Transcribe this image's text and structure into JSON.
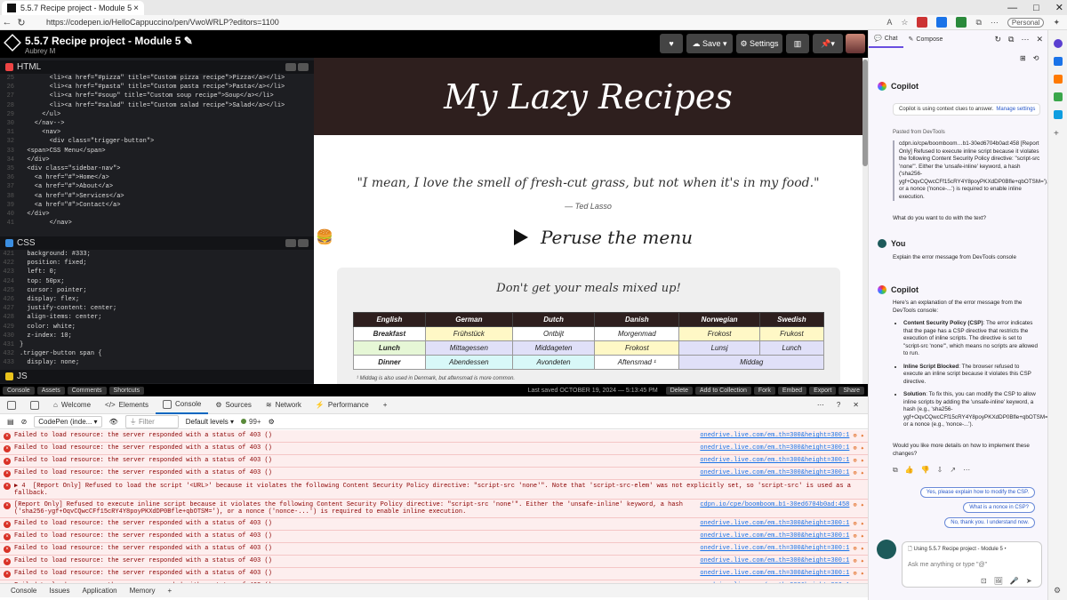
{
  "browser": {
    "tab_title": "5.5.7 Recipe project - Module 5",
    "url": "https://codepen.io/HelloCappuccino/pen/VwoWRLP?editors=1100",
    "profile": "Personal"
  },
  "codepen": {
    "title": "5.5.7 Recipe project - Module 5",
    "user": "Aubrey M",
    "save": "Save",
    "settings": "Settings",
    "footer": {
      "buttons": [
        "Console",
        "Assets",
        "Comments",
        "Shortcuts"
      ],
      "saved": "Last saved OCTOBER 19, 2024 — 5:13:45 PM",
      "actions": [
        "Delete",
        "Add to Collection",
        "Fork",
        "Embed",
        "Export",
        "Share"
      ]
    }
  },
  "editors": {
    "html_label": "HTML",
    "css_label": "CSS",
    "js_label": "JS",
    "html_lines": [
      {
        "n": "25",
        "t": "        <li><a href=\"#pizza\" title=\"Custom pizza recipe\">Pizza</a></li>"
      },
      {
        "n": "26",
        "t": "        <li><a href=\"#pasta\" title=\"Custom pasta recipe\">Pasta</a></li>"
      },
      {
        "n": "27",
        "t": "        <li><a href=\"#soup\" title=\"Custom soup recipe\">Soup</a></li>"
      },
      {
        "n": "28",
        "t": "        <li><a href=\"#salad\" title=\"Custom salad recipe\">Salad</a></li>"
      },
      {
        "n": "29",
        "t": "      </ul>"
      },
      {
        "n": "30",
        "t": "    </nav-->"
      },
      {
        "n": "31",
        "t": "      <nav>"
      },
      {
        "n": "32",
        "t": "        <div class=\"trigger-button\">"
      },
      {
        "n": "33",
        "t": "  <span>CSS Menu</span>"
      },
      {
        "n": "34",
        "t": "  </div>"
      },
      {
        "n": "35",
        "t": "  <div class=\"sidebar-nav\">"
      },
      {
        "n": "36",
        "t": "    <a href=\"#\">Home</a>"
      },
      {
        "n": "37",
        "t": "    <a href=\"#\">About</a>"
      },
      {
        "n": "38",
        "t": "    <a href=\"#\">Services</a>"
      },
      {
        "n": "39",
        "t": "    <a href=\"#\">Contact</a>"
      },
      {
        "n": "40",
        "t": "  </div>"
      },
      {
        "n": "41",
        "t": "        </nav>"
      }
    ],
    "css_lines": [
      {
        "n": "421",
        "t": "  background: #333;"
      },
      {
        "n": "422",
        "t": "  position: fixed;"
      },
      {
        "n": "423",
        "t": "  left: 0;"
      },
      {
        "n": "424",
        "t": "  top: 50px;"
      },
      {
        "n": "425",
        "t": "  cursor: pointer;"
      },
      {
        "n": "426",
        "t": "  display: flex;"
      },
      {
        "n": "427",
        "t": "  justify-content: center;"
      },
      {
        "n": "428",
        "t": "  align-items: center;"
      },
      {
        "n": "429",
        "t": "  color: white;"
      },
      {
        "n": "430",
        "t": "  z-index: 10;"
      },
      {
        "n": "431",
        "t": "}"
      },
      {
        "n": "432",
        "t": ".trigger-button span {"
      },
      {
        "n": "433",
        "t": "  display: none;"
      }
    ]
  },
  "preview": {
    "banner": "My Lazy Recipes",
    "quote": "\"I mean, I love the smell of fresh-cut grass, but not when it's in my food.\"",
    "quote_by": "— Ted Lasso",
    "peruse": "Peruse the menu",
    "card_title": "Don't get your meals mixed up!",
    "table": {
      "headers": [
        "English",
        "German",
        "Dutch",
        "Danish",
        "Norwegian",
        "Swedish"
      ],
      "rows": [
        {
          "cells": [
            "Breakfast",
            "Frühstück",
            "Ontbijt",
            "Morgenmad",
            "Frokost",
            "Frukost"
          ],
          "colors": [
            "#fff",
            "#fff8c6",
            "#fff",
            "#fff",
            "#fff8c6",
            "#fff8c6"
          ]
        },
        {
          "cells": [
            "Lunch",
            "Mittagessen",
            "Middageten",
            "Frokost",
            "Lunsj",
            "Lunch"
          ],
          "colors": [
            "#e6f7d6",
            "#e0e0f8",
            "#e0e0f8",
            "#fff8c6",
            "#e0e0f8",
            "#e0e0f8"
          ]
        },
        {
          "cells": [
            "Dinner",
            "Abendessen",
            "Avondeten",
            "Aftensmad ¹",
            "Middag"
          ],
          "colors": [
            "#fff",
            "#d8f8f8",
            "#d8f8f8",
            "#fff",
            "#e0e0f8"
          ]
        }
      ],
      "note": "¹ Middag is also used in Denmark, but aftensmad is more common."
    }
  },
  "devtools": {
    "tabs": [
      "Welcome",
      "Elements",
      "Console",
      "Sources",
      "Network",
      "Performance"
    ],
    "context": "CodePen (inde...",
    "filter": "Filter",
    "levels": "Default levels",
    "issues": "99+",
    "messages": [
      {
        "text": "Failed to load resource: the server responded with a status of 403 ()",
        "src": "onedrive.live.com/em…th=300&height=300:1"
      },
      {
        "text": "Failed to load resource: the server responded with a status of 403 ()",
        "src": "onedrive.live.com/em…th=300&height=300:1"
      },
      {
        "text": "Failed to load resource: the server responded with a status of 403 ()",
        "src": "onedrive.live.com/em…th=300&height=300:1"
      },
      {
        "text": "Failed to load resource: the server responded with a status of 403 ()",
        "src": "onedrive.live.com/em…th=300&height=300:1"
      },
      {
        "text": "▶ 4  [Report Only] Refused to load the script '<URL>' because it violates the following Content Security Policy directive: \"script-src 'none'\". Note that 'script-src-elem' was not explicitly set, so 'script-src' is used as a fallback.",
        "src": ""
      },
      {
        "text": "[Report Only] Refused to execute inline script because it violates the following Content Security Policy directive: \"script-src 'none'\". Either the 'unsafe-inline' keyword, a hash ('sha256-ygf+OqvCQwcCFf15cRY4Y8poyPKXdDP0Bfle+qbOTSM='), or a nonce ('nonce-...') is required to enable inline execution.",
        "src": "cdpn.io/cpe/boomboom…b1-30ed6704b0ad:458"
      },
      {
        "text": "Failed to load resource: the server responded with a status of 403 ()",
        "src": "onedrive.live.com/em…th=300&height=300:1"
      },
      {
        "text": "Failed to load resource: the server responded with a status of 403 ()",
        "src": "onedrive.live.com/em…th=300&height=300:1"
      },
      {
        "text": "Failed to load resource: the server responded with a status of 403 ()",
        "src": "onedrive.live.com/em…th=300&height=300:1"
      },
      {
        "text": "Failed to load resource: the server responded with a status of 403 ()",
        "src": "onedrive.live.com/em…th=300&height=300:1"
      },
      {
        "text": "Failed to load resource: the server responded with a status of 403 ()",
        "src": "onedrive.live.com/em…th=300&height=300:1"
      },
      {
        "text": "Failed to load resource: the server responded with a status of 403 ()",
        "src": "onedrive.live.com/em…th=300&height=300:1"
      },
      {
        "text": "[Report Only] Refused to execute inline script because it violates the following Content Security Policy directive: \"script-src 'none'\". Either the 'unsafe-inline' keyword, a hash ('sha256-",
        "src": "cdpn.io/cpe/boomboom…e7-06385d3b9c8d:460"
      }
    ],
    "bottom_tabs": [
      "Console",
      "Issues",
      "Application",
      "Memory"
    ]
  },
  "copilot": {
    "tabs": [
      "Chat",
      "Compose"
    ],
    "name": "Copilot",
    "you": "You",
    "context_note": "Copilot is using context clues to answer.",
    "manage": "Manage settings",
    "pasted_label": "Pasted from DevTools",
    "pasted": "cdpn.io/cpe/boomboom…b1-30ed6704b0ad:458 [Report Only] Refused to execute inline script because it violates the following Content Security Policy directive: \"script-src 'none'\". Either the 'unsafe-inline' keyword, a hash ('sha256-ygf+OqvCQwcCFf15cRY4Y8poyPKXdDP0Bfle+qbOTSM='), or a nonce ('nonce-...') is required to enable inline execution.",
    "question": "What do you want to do with the text?",
    "user_msg": "Explain the error message from DevTools console",
    "answer_intro": "Here's an explanation of the error message from the DevTools console:",
    "points": [
      {
        "h": "Content Security Policy (CSP)",
        "t": ": The error indicates that the page has a CSP directive that restricts the execution of inline scripts. The directive is set to \"script-src 'none'\", which means no scripts are allowed to run."
      },
      {
        "h": "Inline Script Blocked",
        "t": ": The browser refused to execute an inline script because it violates this CSP directive."
      },
      {
        "h": "Solution",
        "t": ": To fix this, you can modify the CSP to allow inline scripts by adding the 'unsafe-inline' keyword, a hash (e.g., 'sha256-ygf+OqvCQwcCFf15cRY4Y8poyPKXdDP0Bfle+qbOTSM='), or a nonce (e.g., 'nonce-...')."
      }
    ],
    "followup": "Would you like more details on how to implement these changes?",
    "suggestions": [
      "Yes, please explain how to modify the CSP.",
      "What is a nonce in CSP?",
      "No, thank you. I understand now."
    ],
    "using": "Using 5.5.7 Recipe project - Module 5",
    "placeholder": "Ask me anything or type \"@\""
  }
}
